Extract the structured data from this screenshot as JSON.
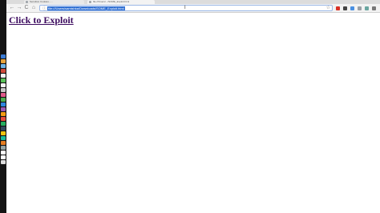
{
  "browser": {
    "tabs": [
      {
        "label": "Sensitive Cookies - ...",
        "favicon": "document-icon",
        "active": false
      },
      {
        "label": "file:///Users/.../SOME_Exploit.html",
        "favicon": "document-icon",
        "active": true
      }
    ],
    "nav": {
      "back_icon": "←",
      "forward_icon": "→",
      "reload_icon": "C",
      "home_icon": "⌂"
    },
    "omnibox": {
      "page_icon": "ⓘ",
      "url": "file:///Users/samishka/Downloads/SOME_Exploit.html",
      "star_icon": "☆"
    },
    "extensions": [
      {
        "name": "red-extension-icon",
        "color": "#d93025"
      },
      {
        "name": "dark-extension-icon",
        "color": "#444444"
      },
      {
        "name": "blue-extension-icon",
        "color": "#4a90e2"
      },
      {
        "name": "gray-extension-icon",
        "color": "#9aa0a6"
      },
      {
        "name": "teal-extension-icon",
        "color": "#6aa6a0"
      },
      {
        "name": "menu-icon",
        "color": "#777777"
      }
    ]
  },
  "dock": {
    "icons": [
      "#3b7bd4",
      "#e8a33b",
      "#6fb3e6",
      "#d14a3a",
      "#f2f2f2",
      "#5ac35a",
      "#f2f2f2",
      "#c8c8c8",
      "#e05a8a",
      "#4caf50",
      "#2e86de",
      "#9b59b6",
      "#f39c12",
      "#e74c3c",
      "#27ae60",
      "#34495e",
      "#f1c40f",
      "#1abc9c",
      "#e67e22",
      "#95a5a6",
      "#ffffff",
      "#ffffff",
      "#dddddd"
    ]
  },
  "content": {
    "link_text": "Click to Exploit"
  }
}
